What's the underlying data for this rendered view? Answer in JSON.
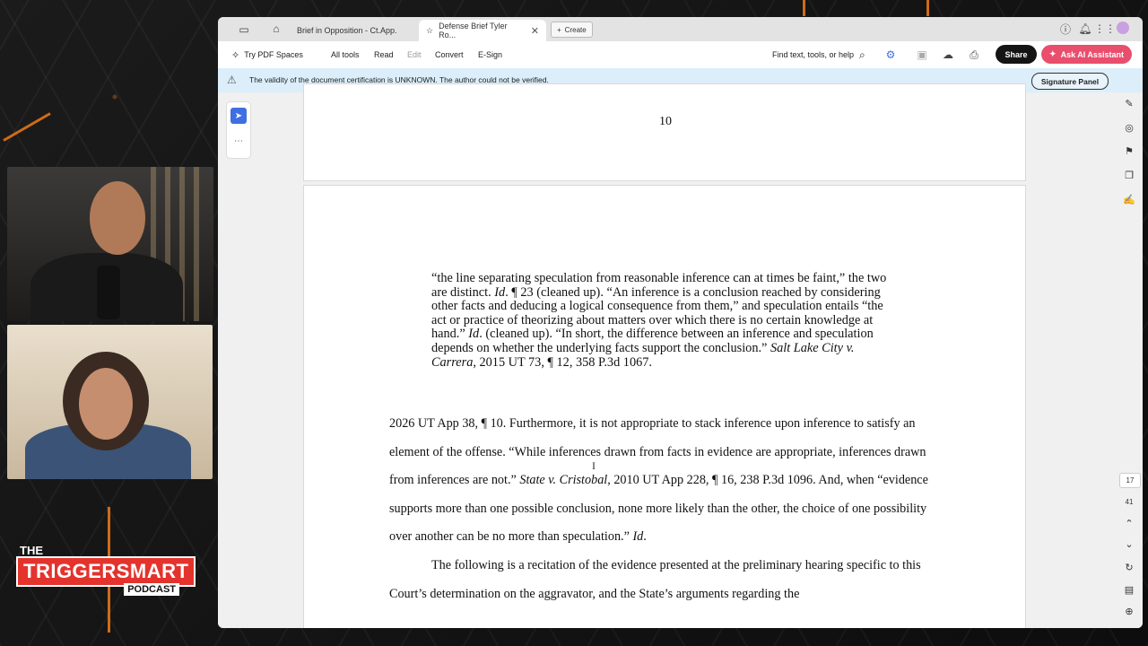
{
  "app": {
    "tabs": [
      {
        "label": "Brief in Opposition - Ct.App."
      },
      {
        "label": "Defense Brief Tyler Ro..."
      }
    ],
    "new_tab_label": "Create",
    "toolbar": {
      "try_spaces": "Try PDF Spaces",
      "all_tools": "All tools",
      "read": "Read",
      "edit": "Edit",
      "convert": "Convert",
      "esign": "E-Sign",
      "find": "Find text, tools, or help",
      "share": "Share",
      "ai_assistant": "Ask AI Assistant"
    },
    "banner": {
      "message": "The validity of the document certification is UNKNOWN. The author could not be verified.",
      "signature_panel": "Signature Panel"
    },
    "document": {
      "page_number": "10",
      "blockquote": [
        {
          "t": "“the line separating speculation from reasonable inference can at times be faint,” the two are distinct. "
        },
        {
          "t": "Id",
          "i": true
        },
        {
          "t": ". ¶ 23 (cleaned up). “An inference is a conclusion reached by considering other facts and deducing a logical consequence from them,” and speculation entails “the act or practice of theorizing about matters over which there is no certain knowledge at hand.” "
        },
        {
          "t": "Id",
          "i": true
        },
        {
          "t": ". (cleaned up). “In short, the difference between an inference and speculation depends on whether the underlying facts support the conclusion.” "
        },
        {
          "t": "Salt Lake City v. Carrera",
          "i": true
        },
        {
          "t": ", 2015 UT 73, ¶ 12, 358 P.3d 1067."
        }
      ],
      "paragraph1": [
        {
          "t": "2026 UT App 38, ¶ 10. Furthermore, it is not appropriate to stack inference upon inference to satisfy an element of the offense. “While inferences drawn from facts in evidence are appropriate, inferences drawn from inferences are not.” "
        },
        {
          "t": "State v. Cristobal",
          "i": true
        },
        {
          "t": ", 2010 UT App 228, ¶ 16, 238 P.3d 1096. And, when “evidence supports more than one possible conclusion, none more likely than the other, the choice of one possibility over another can be no more than speculation.” "
        },
        {
          "t": "Id",
          "i": true
        },
        {
          "t": "."
        }
      ],
      "paragraph2": "The following is a recitation of the evidence presented at the preliminary hearing specific to this Court’s determination on the aggravator, and the State’s arguments regarding the"
    },
    "page_indicator": {
      "current": "17",
      "total": "41"
    }
  },
  "overlay": {
    "logo_the": "THE",
    "logo_main": "TRIGGERSMART",
    "logo_podcast": "PODCAST"
  },
  "colors": {
    "accent_orange": "#f07a1a",
    "ai_button": "#e94e6d",
    "banner_bg": "#dbeefa",
    "select_tool": "#3f6fe0"
  }
}
